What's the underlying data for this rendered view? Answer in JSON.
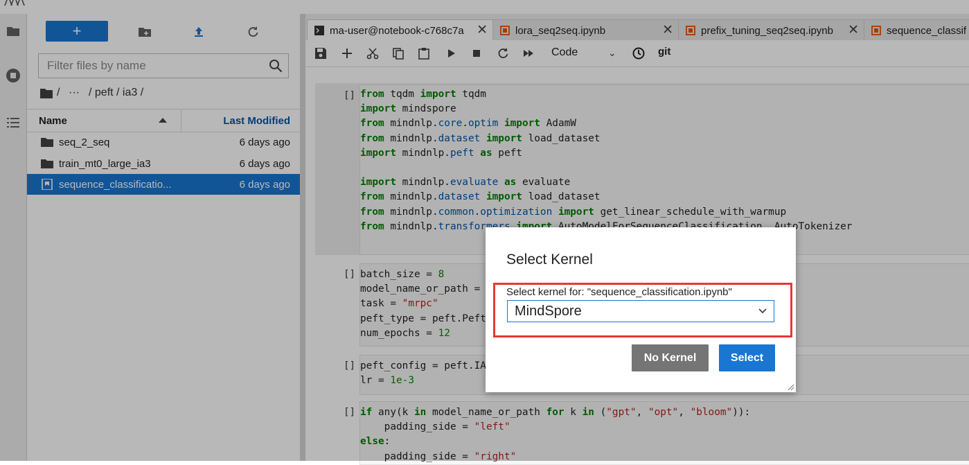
{
  "file_browser": {
    "filter_placeholder": "Filter files by name",
    "breadcrumb": [
      "/",
      "···",
      "/ peft / ia3 /"
    ],
    "headers": {
      "name": "Name",
      "modified": "Last Modified"
    },
    "rows": [
      {
        "name": "seq_2_seq",
        "modified": "6 days ago",
        "type": "folder"
      },
      {
        "name": "train_mt0_large_ia3",
        "modified": "6 days ago",
        "type": "folder"
      },
      {
        "name": "sequence_classificatio...",
        "modified": "6 days ago",
        "type": "notebook"
      }
    ]
  },
  "tabs": [
    {
      "label": "ma-user@notebook-c768c7a",
      "icon": "terminal-icon"
    },
    {
      "label": "lora_seq2seq.ipynb",
      "icon": "notebook-icon"
    },
    {
      "label": "prefix_tuning_seq2seq.ipynb",
      "icon": "notebook-icon"
    },
    {
      "label": "sequence_classif",
      "icon": "notebook-icon"
    }
  ],
  "notebook_toolbar": {
    "cell_type": "Code",
    "git_label": "git"
  },
  "cells": [
    {
      "prompt": "[]"
    },
    {
      "prompt": "[]"
    },
    {
      "prompt": "[]"
    },
    {
      "prompt": "[]"
    }
  ],
  "dialog": {
    "title": "Select Kernel",
    "label": "Select kernel for: \"sequence_classification.ipynb\"",
    "selected_kernel": "MindSpore",
    "no_kernel_label": "No Kernel",
    "select_label": "Select"
  },
  "colors": {
    "accent": "#1976d2",
    "highlight_box": "#e53935",
    "secondary_button": "#757575"
  }
}
